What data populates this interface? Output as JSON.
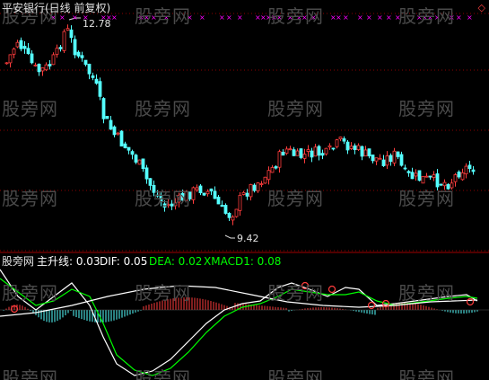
{
  "header": {
    "title": "平安银行(日线 前复权)",
    "high_label": "12.78",
    "low_label": "9.42",
    "corner_icon": "diamond-icon"
  },
  "indicator_bar": {
    "source": "股旁网",
    "main_label": "主升线: 0.03",
    "dif_label": "DIF: 0.05",
    "dea_label": "DEA: 0.02",
    "xmacd_label": "XMACD1: 0.08",
    "colors": {
      "main": "#ffffff",
      "dif": "#ffffff",
      "dea": "#00ff00",
      "xmacd": "#00ff00"
    }
  },
  "watermark": "股旁网",
  "colors": {
    "background": "#000000",
    "up": "#ff3c3c",
    "down": "#54ffff",
    "grid": "#8b0000",
    "marker": "#ff00ff",
    "macd_pos": "#ff3c3c",
    "macd_neg": "#54ffff"
  },
  "chart_data": {
    "type": "candlestick",
    "price_high": 12.78,
    "price_low": 9.42,
    "ylim": [
      9.3,
      13.0
    ],
    "indicators": {
      "主升线": 0.03,
      "DIF": 0.05,
      "DEA": 0.02,
      "XMACD1": 0.08
    }
  }
}
